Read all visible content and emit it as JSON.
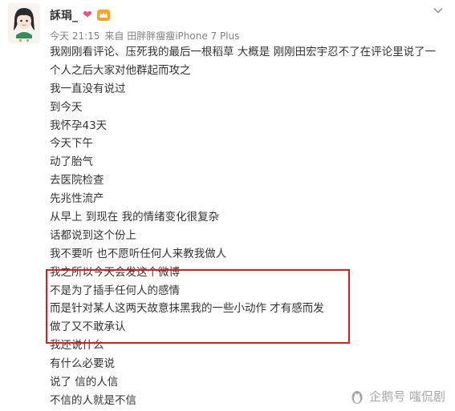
{
  "post": {
    "username": "訸琄_",
    "meta": {
      "time": "今天 21:15",
      "source": "来自 田胖胖瘦瘦iPhone 7 Plus"
    },
    "lines": [
      "我刚刚看评论、压死我的最后一根稻草 大概是 刚刚田宏宇忍不了在评论里说了一",
      "个人之后大家对他群起而攻之",
      "我一直没有说过",
      "到今天",
      "我怀孕43天",
      "今天下午",
      "动了胎气",
      "去医院检查",
      "先兆性流产",
      "从早上 到现在 我的情绪变化很复杂",
      "话都说到这个份上",
      "我不要听 也不愿听任何人来教我做人",
      "我之所以今天会发这个微博",
      "不是为了插手任何人的感情",
      "而是针对某人这两天故意抹黑我的一些小动作 才有感而发",
      "做了又不敢承认",
      "我还说什么",
      "有什么必要说",
      "说了 信的人信",
      "不信的人就是不信"
    ]
  },
  "watermark": {
    "text": "企鹅号 嗤侃剧"
  },
  "colors": {
    "highlight_border": "#d41f1f",
    "text": "#333333",
    "meta": "#808080",
    "heart_badge": "#e8508a",
    "crown_badge": "#f5a623"
  },
  "icons": [
    "heart-badge-icon",
    "crown-badge-icon",
    "chevron-down-icon",
    "penguin-icon"
  ]
}
